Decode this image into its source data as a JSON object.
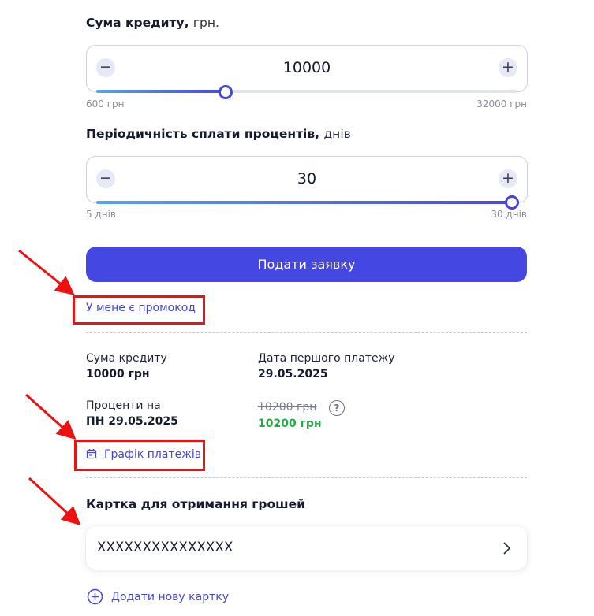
{
  "loan_amount": {
    "title": "Сума кредиту,",
    "unit": "грн.",
    "value": "10000",
    "min_label": "600 грн",
    "max_label": "32000 грн",
    "minus": "−",
    "plus": "+",
    "fill_fraction": 0.3
  },
  "interest_period": {
    "title": "Періодичність сплати процентів,",
    "unit": "днів",
    "value": "30",
    "min_label": "5 днів",
    "max_label": "30 днів",
    "minus": "−",
    "plus": "+",
    "fill_fraction": 1.0
  },
  "submit_label": "Подати заявку",
  "promo_link": "У мене є промокод",
  "summary": {
    "loan_label": "Сума кредиту",
    "loan_value": "10000 грн",
    "first_payment_label": "Дата першого платежу",
    "first_payment_value": "29.05.2025",
    "interest_label": "Проценти на",
    "interest_date": "ПН 29.05.2025",
    "old_total": "10200 грн",
    "new_total": "10200 грн",
    "help_glyph": "?"
  },
  "schedule_link": "Графік платежів",
  "card_section": {
    "title": "Картка для отримання грошей",
    "card_number": "XXXXXXXXXXXXXXX",
    "add_card_label": "Додати нову картку"
  },
  "colors": {
    "accent": "#4547e2",
    "annotation_red": "#ee1111",
    "success_green": "#28a745"
  }
}
